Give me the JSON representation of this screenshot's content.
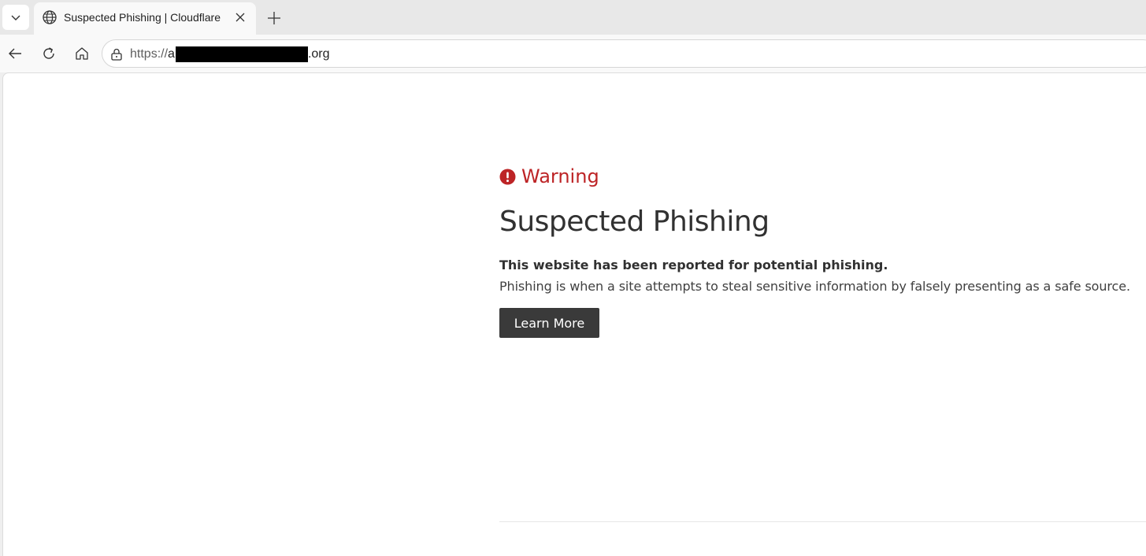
{
  "browser": {
    "tab": {
      "title": "Suspected Phishing | Cloudflare",
      "favicon": "globe-icon"
    },
    "address": {
      "scheme": "https://",
      "visible_prefix_char": "a",
      "redacted": true,
      "suffix": ".org"
    },
    "icons": {
      "tab_list": "chevron-down-icon",
      "close": "close-icon",
      "new_tab": "plus-icon",
      "back": "back-arrow-icon",
      "reload": "reload-icon",
      "home": "home-icon",
      "lock": "lock-icon"
    }
  },
  "page": {
    "warning_label": "Warning",
    "title": "Suspected Phishing",
    "lead": "This website has been reported for potential phishing.",
    "description": "Phishing is when a site attempts to steal sensitive information by falsely presenting as a safe source.",
    "learn_more_label": "Learn More"
  },
  "colors": {
    "warning_red": "#bd2426",
    "button_bg": "#3a3a3a",
    "text_dark": "#313131"
  }
}
